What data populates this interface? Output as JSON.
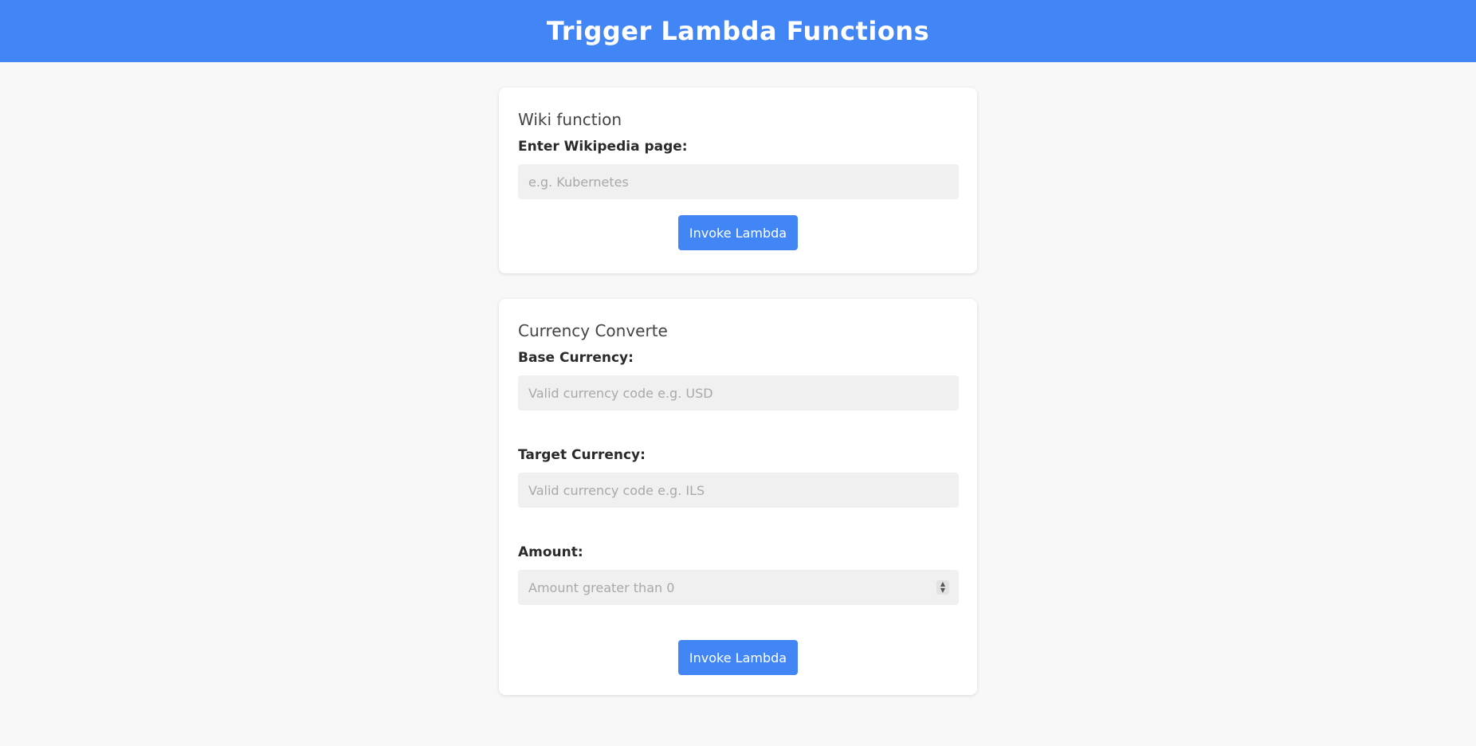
{
  "header": {
    "title": "Trigger Lambda Functions"
  },
  "wiki": {
    "title": "Wiki function",
    "page_label": "Enter Wikipedia page:",
    "page_placeholder": "e.g. Kubernetes",
    "page_value": "",
    "button_label": "Invoke Lambda"
  },
  "currency": {
    "title": "Currency Converte",
    "base_label": "Base Currency:",
    "base_placeholder": "Valid currency code e.g. USD",
    "base_value": "",
    "target_label": "Target Currency:",
    "target_placeholder": "Valid currency code e.g. ILS",
    "target_value": "",
    "amount_label": "Amount:",
    "amount_placeholder": "Amount greater than 0",
    "amount_value": "",
    "button_label": "Invoke Lambda"
  },
  "icons": {
    "spinner_up": "▲",
    "spinner_down": "▼"
  },
  "colors": {
    "accent": "#4285f4",
    "background": "#f7f8f7",
    "input_bg": "#f0f0f0"
  }
}
